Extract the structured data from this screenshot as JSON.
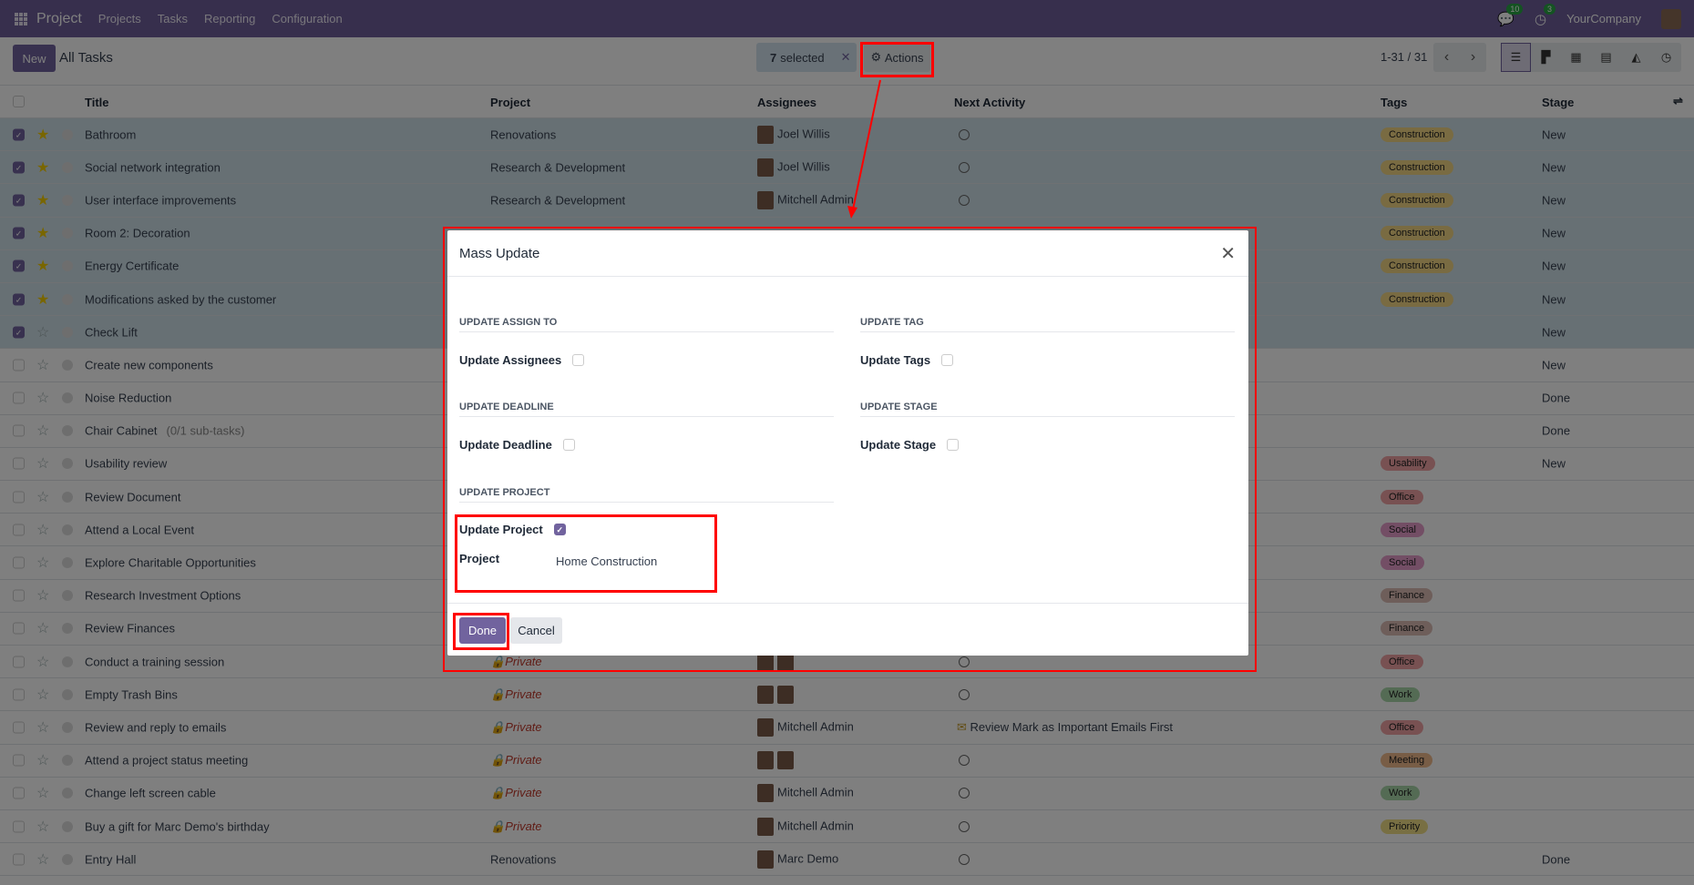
{
  "navbar": {
    "app": "Project",
    "menu": [
      "Projects",
      "Tasks",
      "Reporting",
      "Configuration"
    ],
    "messages_count": "10",
    "activities_count": "3",
    "company": "YourCompany"
  },
  "control": {
    "new_label": "New",
    "breadcrumb": "All Tasks",
    "selected_count": "7",
    "selected_label": "selected",
    "actions_label": "Actions",
    "pager": "1-31 / 31"
  },
  "columns": {
    "title": "Title",
    "project": "Project",
    "assignees": "Assignees",
    "next_activity": "Next Activity",
    "tags": "Tags",
    "stage": "Stage"
  },
  "tag_colors": {
    "Construction": "#f2d785",
    "Usability": "#f0a3a5",
    "Office": "#f0a3a5",
    "Social": "#e69ccb",
    "Finance": "#dcbcb5",
    "Work": "#a9d6a9",
    "Meeting": "#f0ba8c",
    "Priority": "#f1df87"
  },
  "rows": [
    {
      "title": "Bathroom",
      "project": "Renovations",
      "assignees": [
        "Joel Willis"
      ],
      "activity": "clock",
      "tag": "Construction",
      "stage": "New",
      "selected": true,
      "starred": true
    },
    {
      "title": "Social network integration",
      "project": "Research & Development",
      "assignees": [
        "Joel Willis"
      ],
      "activity": "clock",
      "tag": "Construction",
      "stage": "New",
      "selected": true,
      "starred": true
    },
    {
      "title": "User interface improvements",
      "project": "Research & Development",
      "assignees": [
        "Mitchell Admin"
      ],
      "activity": "clock",
      "tag": "Construction",
      "stage": "New",
      "selected": true,
      "starred": true
    },
    {
      "title": "Room 2: Decoration",
      "tag": "Construction",
      "stage": "New",
      "selected": true,
      "starred": true
    },
    {
      "title": "Energy Certificate",
      "tag": "Construction",
      "stage": "New",
      "selected": true,
      "starred": true
    },
    {
      "title": "Modifications asked by the customer",
      "tag": "Construction",
      "stage": "New",
      "selected": true,
      "starred": true
    },
    {
      "title": "Check Lift",
      "stage": "New",
      "selected": true,
      "starred": false
    },
    {
      "title": "Create new components",
      "stage": "New"
    },
    {
      "title": "Noise Reduction",
      "stage": "Done"
    },
    {
      "title": "Chair Cabinet",
      "subtasks": "(0/1 sub-tasks)",
      "stage": "Done"
    },
    {
      "title": "Usability review",
      "tag": "Usability",
      "stage": "New"
    },
    {
      "title": "Review Document",
      "tag": "Office"
    },
    {
      "title": "Attend a Local Event",
      "tag": "Social"
    },
    {
      "title": "Explore Charitable Opportunities",
      "tag": "Social"
    },
    {
      "title": "Research Investment Options",
      "tag": "Finance"
    },
    {
      "title": "Review Finances",
      "tag": "Finance"
    },
    {
      "title": "Conduct a training session",
      "project": "Private",
      "private": true,
      "assignees": [
        "",
        ""
      ],
      "activity": "clock",
      "tag": "Office"
    },
    {
      "title": "Empty Trash Bins",
      "project": "Private",
      "private": true,
      "assignees": [
        "",
        ""
      ],
      "activity": "clock",
      "tag": "Work"
    },
    {
      "title": "Review and reply to emails",
      "project": "Private",
      "private": true,
      "assignees": [
        "Mitchell Admin"
      ],
      "activity": "Review Mark as Important Emails First",
      "tag": "Office"
    },
    {
      "title": "Attend a project status meeting",
      "project": "Private",
      "private": true,
      "assignees": [
        "",
        ""
      ],
      "activity": "clock",
      "tag": "Meeting"
    },
    {
      "title": "Change left screen cable",
      "project": "Private",
      "private": true,
      "assignees": [
        "Mitchell Admin"
      ],
      "activity": "clock",
      "tag": "Work"
    },
    {
      "title": "Buy a gift for Marc Demo's birthday",
      "project": "Private",
      "private": true,
      "assignees": [
        "Mitchell Admin"
      ],
      "activity": "clock",
      "tag": "Priority"
    },
    {
      "title": "Entry Hall",
      "project": "Renovations",
      "assignees": [
        "Marc Demo"
      ],
      "activity": "clock",
      "stage": "Done"
    }
  ],
  "dialog": {
    "title": "Mass Update",
    "sections": {
      "assign": "UPDATE ASSIGN TO",
      "tag": "UPDATE TAG",
      "deadline": "UPDATE DEADLINE",
      "stage": "UPDATE STAGE",
      "project": "UPDATE PROJECT"
    },
    "fields": {
      "assignees": "Update Assignees",
      "tags": "Update Tags",
      "deadline": "Update Deadline",
      "stage": "Update Stage",
      "project": "Update Project",
      "project_label": "Project",
      "project_value": "Home Construction"
    },
    "update_project_checked": true,
    "done_label": "Done",
    "cancel_label": "Cancel"
  }
}
